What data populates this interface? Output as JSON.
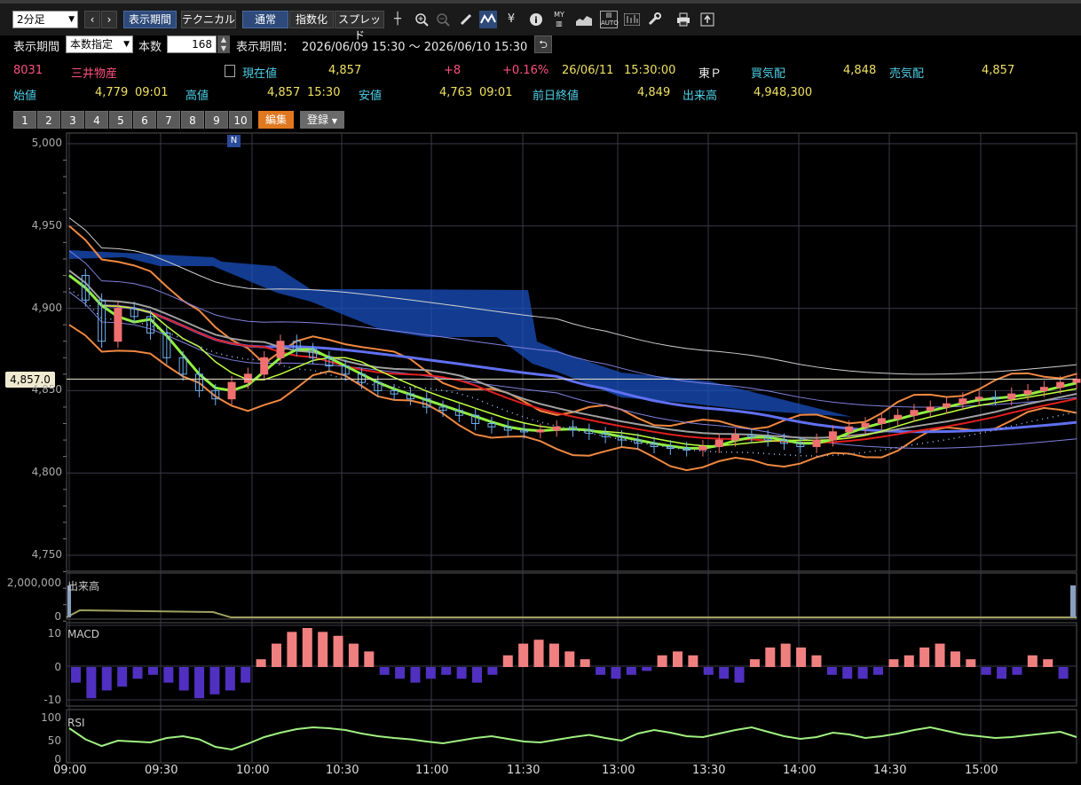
{
  "toolbar": {
    "interval": "2分足",
    "display_period_btn": "表示期間",
    "technical_btn": "テクニカル",
    "normal_btn": "通常",
    "index_btn": "指数化",
    "spread_btn": "スプレッド",
    "icons": [
      "crosshair-icon",
      "zoom-in-icon",
      "zoom-out-icon",
      "pencil-icon",
      "trend-icon",
      "yen-icon",
      "info-icon",
      "my-icon",
      "area-chart-icon",
      "auto-icon",
      "bar-chart-icon",
      "wrench-icon",
      "print-icon",
      "export-icon"
    ]
  },
  "period": {
    "label": "表示期間",
    "mode": "本数指定",
    "count_label": "本数",
    "count": "168",
    "range_label": "表示期間：",
    "range": "2026/06/09 15:30 ～ 2026/06/10 15:30"
  },
  "quote": {
    "code": "8031",
    "name": "三井物産",
    "current_label": "現在値",
    "current": "4,857",
    "change": "+8",
    "change_pct": "+0.16%",
    "date": "26/06/11",
    "time": "15:30:00",
    "market": "東Ｐ",
    "bid_label": "買気配",
    "bid": "4,848",
    "ask_label": "売気配",
    "ask": "4,857",
    "open_label": "始値",
    "open": "4,779",
    "open_time": "09:01",
    "high_label": "高値",
    "high": "4,857",
    "high_time": "15:30",
    "low_label": "安値",
    "low": "4,763",
    "low_time": "09:01",
    "prev_close_label": "前日終値",
    "prev_close": "4,849",
    "volume_label": "出来高",
    "volume": "4,948,300"
  },
  "presets": [
    "1",
    "2",
    "3",
    "4",
    "5",
    "6",
    "7",
    "8",
    "9",
    "10"
  ],
  "edit_btn": "編集",
  "register_btn": "登録",
  "news_marker": "N",
  "price_axis": [
    "5,000",
    "4,950",
    "4,900",
    "4,850",
    "4,800",
    "4,750"
  ],
  "current_price_tag": "4,857.0",
  "volume_panel": {
    "title": "出来高",
    "axis": [
      "2,000,000",
      "0"
    ]
  },
  "macd_panel": {
    "title": "MACD",
    "axis": [
      "10",
      "0",
      "-10"
    ]
  },
  "rsi_panel": {
    "title": "RSI",
    "axis": [
      "100",
      "50",
      "0"
    ]
  },
  "time_axis": [
    "09:00",
    "09:30",
    "10:00",
    "10:30",
    "11:00",
    "11:30",
    "13:00",
    "13:30",
    "14:00",
    "14:30",
    "15:00"
  ],
  "colors": {
    "bull": "#f07070",
    "bear": "#70b0f0",
    "cloud": "#1a50c0",
    "ma_red": "#e02020",
    "ma_green": "#90f040",
    "ma_blue": "#6070f0",
    "band": "#f08840",
    "rsi": "#a0f080",
    "macd_pos": "#f08080",
    "macd_neg": "#5030c0"
  },
  "chart_data": {
    "type": "candlestick",
    "interval": "2分足",
    "ylim": [
      4740,
      5000
    ],
    "yticks": [
      5000,
      4950,
      4900,
      4850,
      4800,
      4750
    ],
    "close_series": [
      4920,
      4905,
      4880,
      4900,
      4895,
      4885,
      4870,
      4860,
      4850,
      4845,
      4855,
      4860,
      4870,
      4880,
      4875,
      4870,
      4865,
      4860,
      4855,
      4850,
      4848,
      4845,
      4840,
      4838,
      4835,
      4830,
      4828,
      4826,
      4825,
      4826,
      4828,
      4826,
      4824,
      4822,
      4820,
      4818,
      4816,
      4815,
      4814,
      4816,
      4820,
      4823,
      4822,
      4820,
      4818,
      4816,
      4820,
      4825,
      4828,
      4830,
      4833,
      4835,
      4838,
      4840,
      4842,
      4845,
      4846,
      4845,
      4848,
      4850,
      4852,
      4855,
      4857
    ],
    "macd_hist": [
      -4,
      -8,
      -6,
      -5,
      -3,
      -2,
      -4,
      -6,
      -8,
      -7,
      -6,
      -4,
      2,
      6,
      9,
      10,
      9,
      8,
      6,
      4,
      -2,
      -3,
      -4,
      -3,
      -2,
      -3,
      -4,
      -2,
      3,
      6,
      7,
      6,
      4,
      2,
      -2,
      -3,
      -2,
      -1,
      3,
      4,
      3,
      -2,
      -3,
      -4,
      2,
      5,
      6,
      5,
      3,
      -2,
      -3,
      -3,
      -2,
      2,
      3,
      5,
      6,
      4,
      2,
      -2,
      -3,
      -2,
      3,
      2,
      -3
    ],
    "rsi": [
      70,
      45,
      30,
      42,
      40,
      38,
      48,
      52,
      45,
      28,
      22,
      35,
      50,
      60,
      68,
      72,
      70,
      66,
      58,
      52,
      48,
      45,
      40,
      36,
      42,
      48,
      52,
      46,
      40,
      38,
      44,
      50,
      55,
      48,
      42,
      58,
      66,
      60,
      52,
      50,
      58,
      66,
      72,
      62,
      52,
      46,
      50,
      60,
      56,
      48,
      52,
      58,
      66,
      72,
      64,
      56,
      52,
      48,
      50,
      54,
      58,
      62,
      50
    ],
    "volume_max": 2000000
  }
}
